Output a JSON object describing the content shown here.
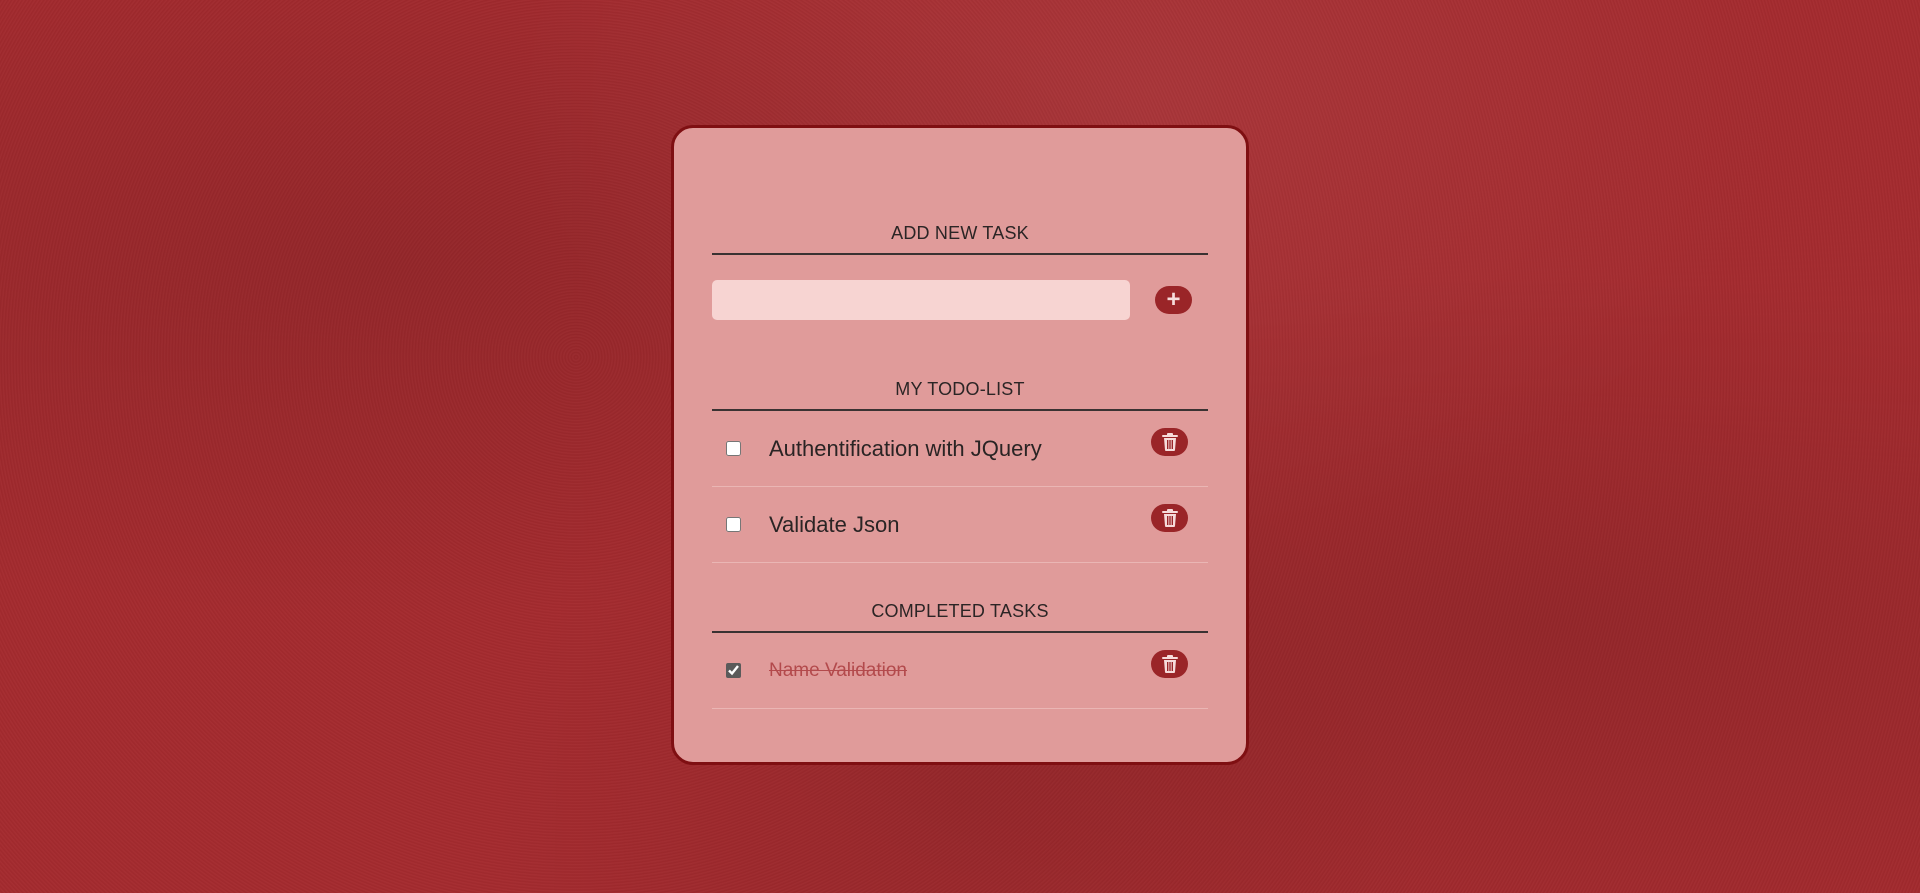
{
  "colors": {
    "background": "#a52a2e",
    "card": "#e09b9a",
    "card_border": "#7f0f12",
    "button": "#9a2528",
    "input": "#f7d4d2",
    "completed_text": "#b34a4c"
  },
  "add_section": {
    "title": "ADD NEW TASK",
    "input_value": "",
    "add_button_icon": "plus-icon",
    "add_button_glyph": "+"
  },
  "todo_section": {
    "title": "MY TODO-LIST",
    "items": [
      {
        "label": "Authentification with JQuery",
        "checked": false,
        "delete_icon": "trash-icon"
      },
      {
        "label": "Validate Json",
        "checked": false,
        "delete_icon": "trash-icon"
      }
    ]
  },
  "completed_section": {
    "title": "COMPLETED TASKS",
    "items": [
      {
        "label": "Name Validation",
        "checked": true,
        "delete_icon": "trash-icon"
      }
    ]
  }
}
